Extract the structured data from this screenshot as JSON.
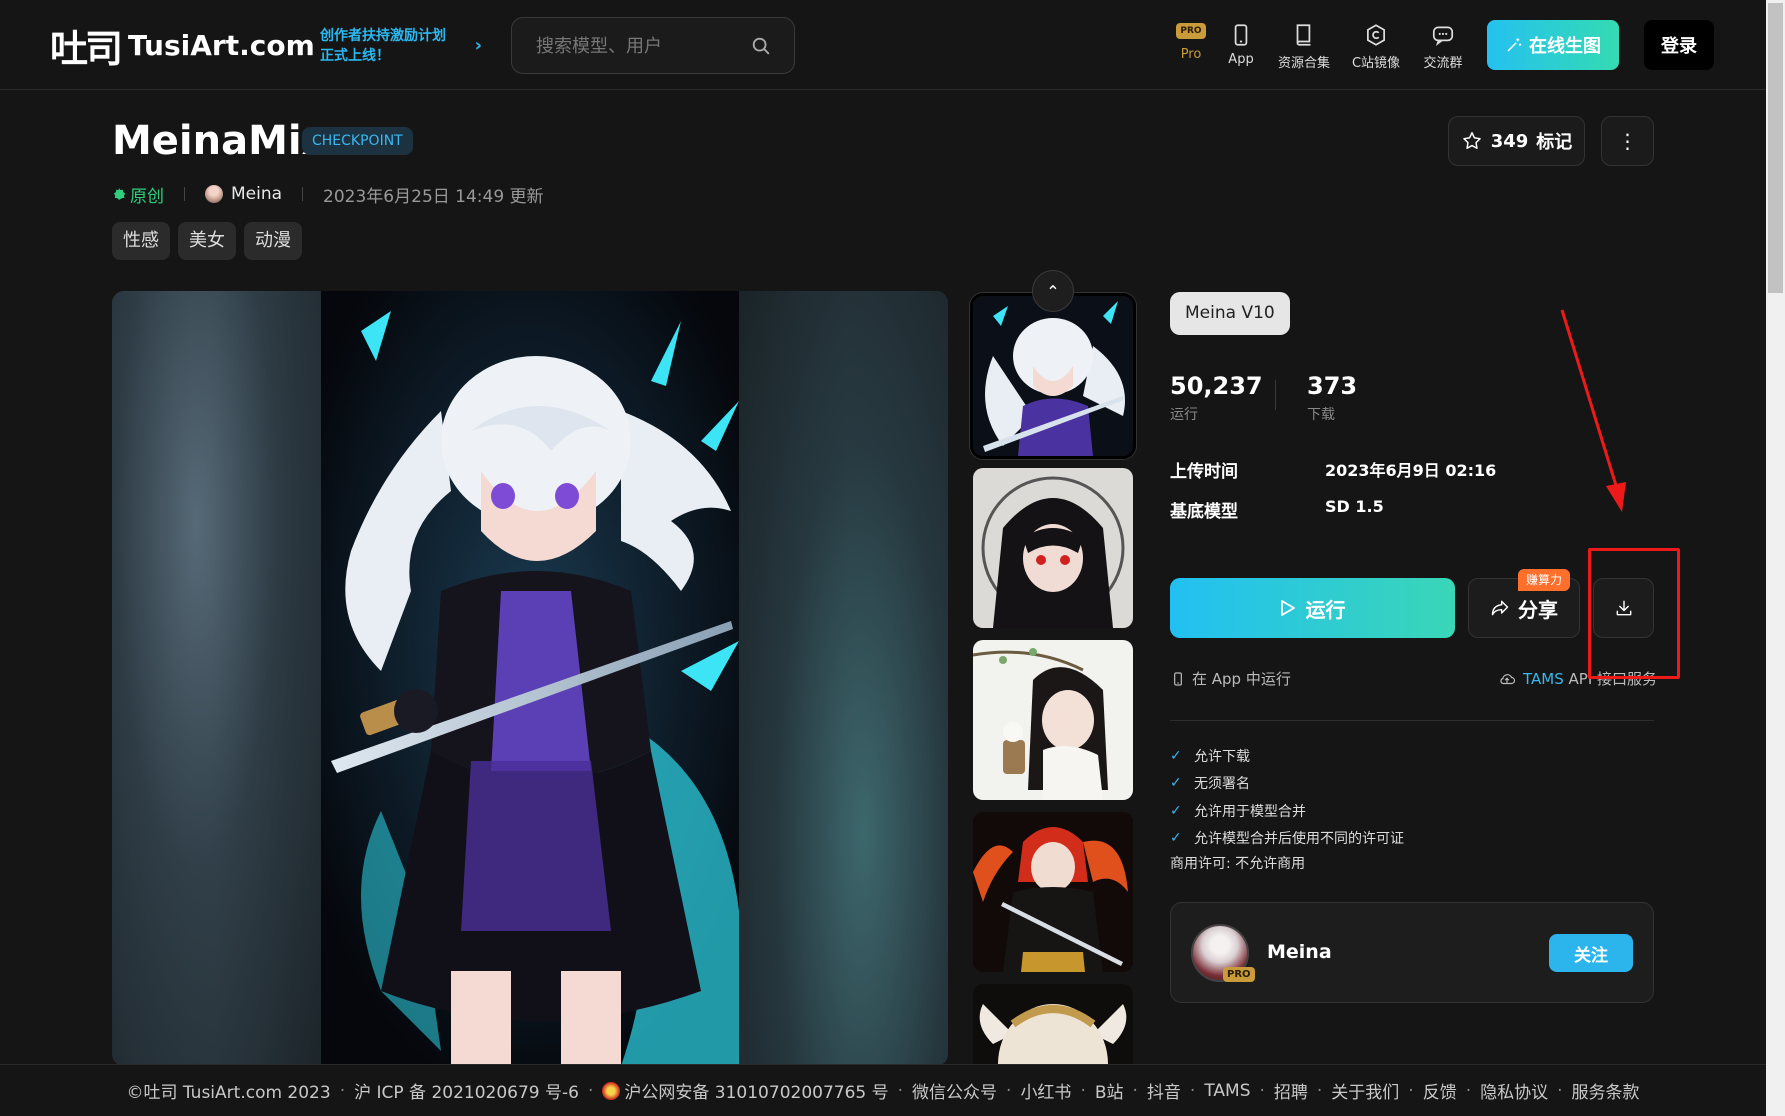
{
  "header": {
    "logo_cn": "吐司",
    "logo_en": "TusiArt.com",
    "promo_line1": "创作者扶持激励计划",
    "promo_line2": "正式上线！",
    "search_placeholder": "搜索模型、用户",
    "nav": [
      {
        "label": "Pro",
        "icon": "pro-badge-icon",
        "badge": "PRO"
      },
      {
        "label": "App",
        "icon": "phone-icon"
      },
      {
        "label": "资源合集",
        "icon": "book-icon"
      },
      {
        "label": "C站镜像",
        "icon": "hexagon-icon"
      },
      {
        "label": "交流群",
        "icon": "chat-icon"
      }
    ],
    "generate_label": "在线生图",
    "login_label": "登录"
  },
  "model": {
    "title": "MeinaMix",
    "type_badge": "CHECKPOINT",
    "original_label": "原创",
    "author": "Meina",
    "updated": "2023年6月25日 14:49 更新",
    "tags": [
      "性感",
      "美女",
      "动漫"
    ],
    "bookmark_count": "349",
    "bookmark_label": "标记"
  },
  "panel": {
    "version": "Meina V10",
    "runs": "50,237",
    "runs_label": "运行",
    "downloads": "373",
    "downloads_label": "下载",
    "upload_time_label": "上传时间",
    "upload_time": "2023年6月9日 02:16",
    "base_model_label": "基底模型",
    "base_model": "SD 1.5",
    "run_label": "运行",
    "share_label": "分享",
    "earn_badge": "赚算力",
    "app_run_label": "在 App 中运行",
    "api_highlight": "TAMS",
    "api_rest": "API 接口服务",
    "permissions": [
      "允许下载",
      "无须署名",
      "允许用于模型合并",
      "允许模型合并后使用不同的许可证"
    ],
    "license": "商用许可: 不允许商用",
    "author_name": "Meina",
    "author_pro": "PRO",
    "follow_label": "关注"
  },
  "footer": {
    "items": [
      "©吐司 TusiArt.com 2023",
      "沪 ICP 备 2021020679 号-6",
      "沪公网安备 31010702007765 号",
      "微信公众号",
      "小红书",
      "B站",
      "抖音",
      "TAMS",
      "招聘",
      "关于我们",
      "反馈",
      "隐私协议",
      "服务条款"
    ]
  },
  "colors": {
    "accent": "#2cb5ec",
    "gradient_start": "#22c0f2",
    "gradient_end": "#3ad6b7",
    "original_green": "#2fcf7e",
    "annotation_red": "#ee1a1a"
  }
}
